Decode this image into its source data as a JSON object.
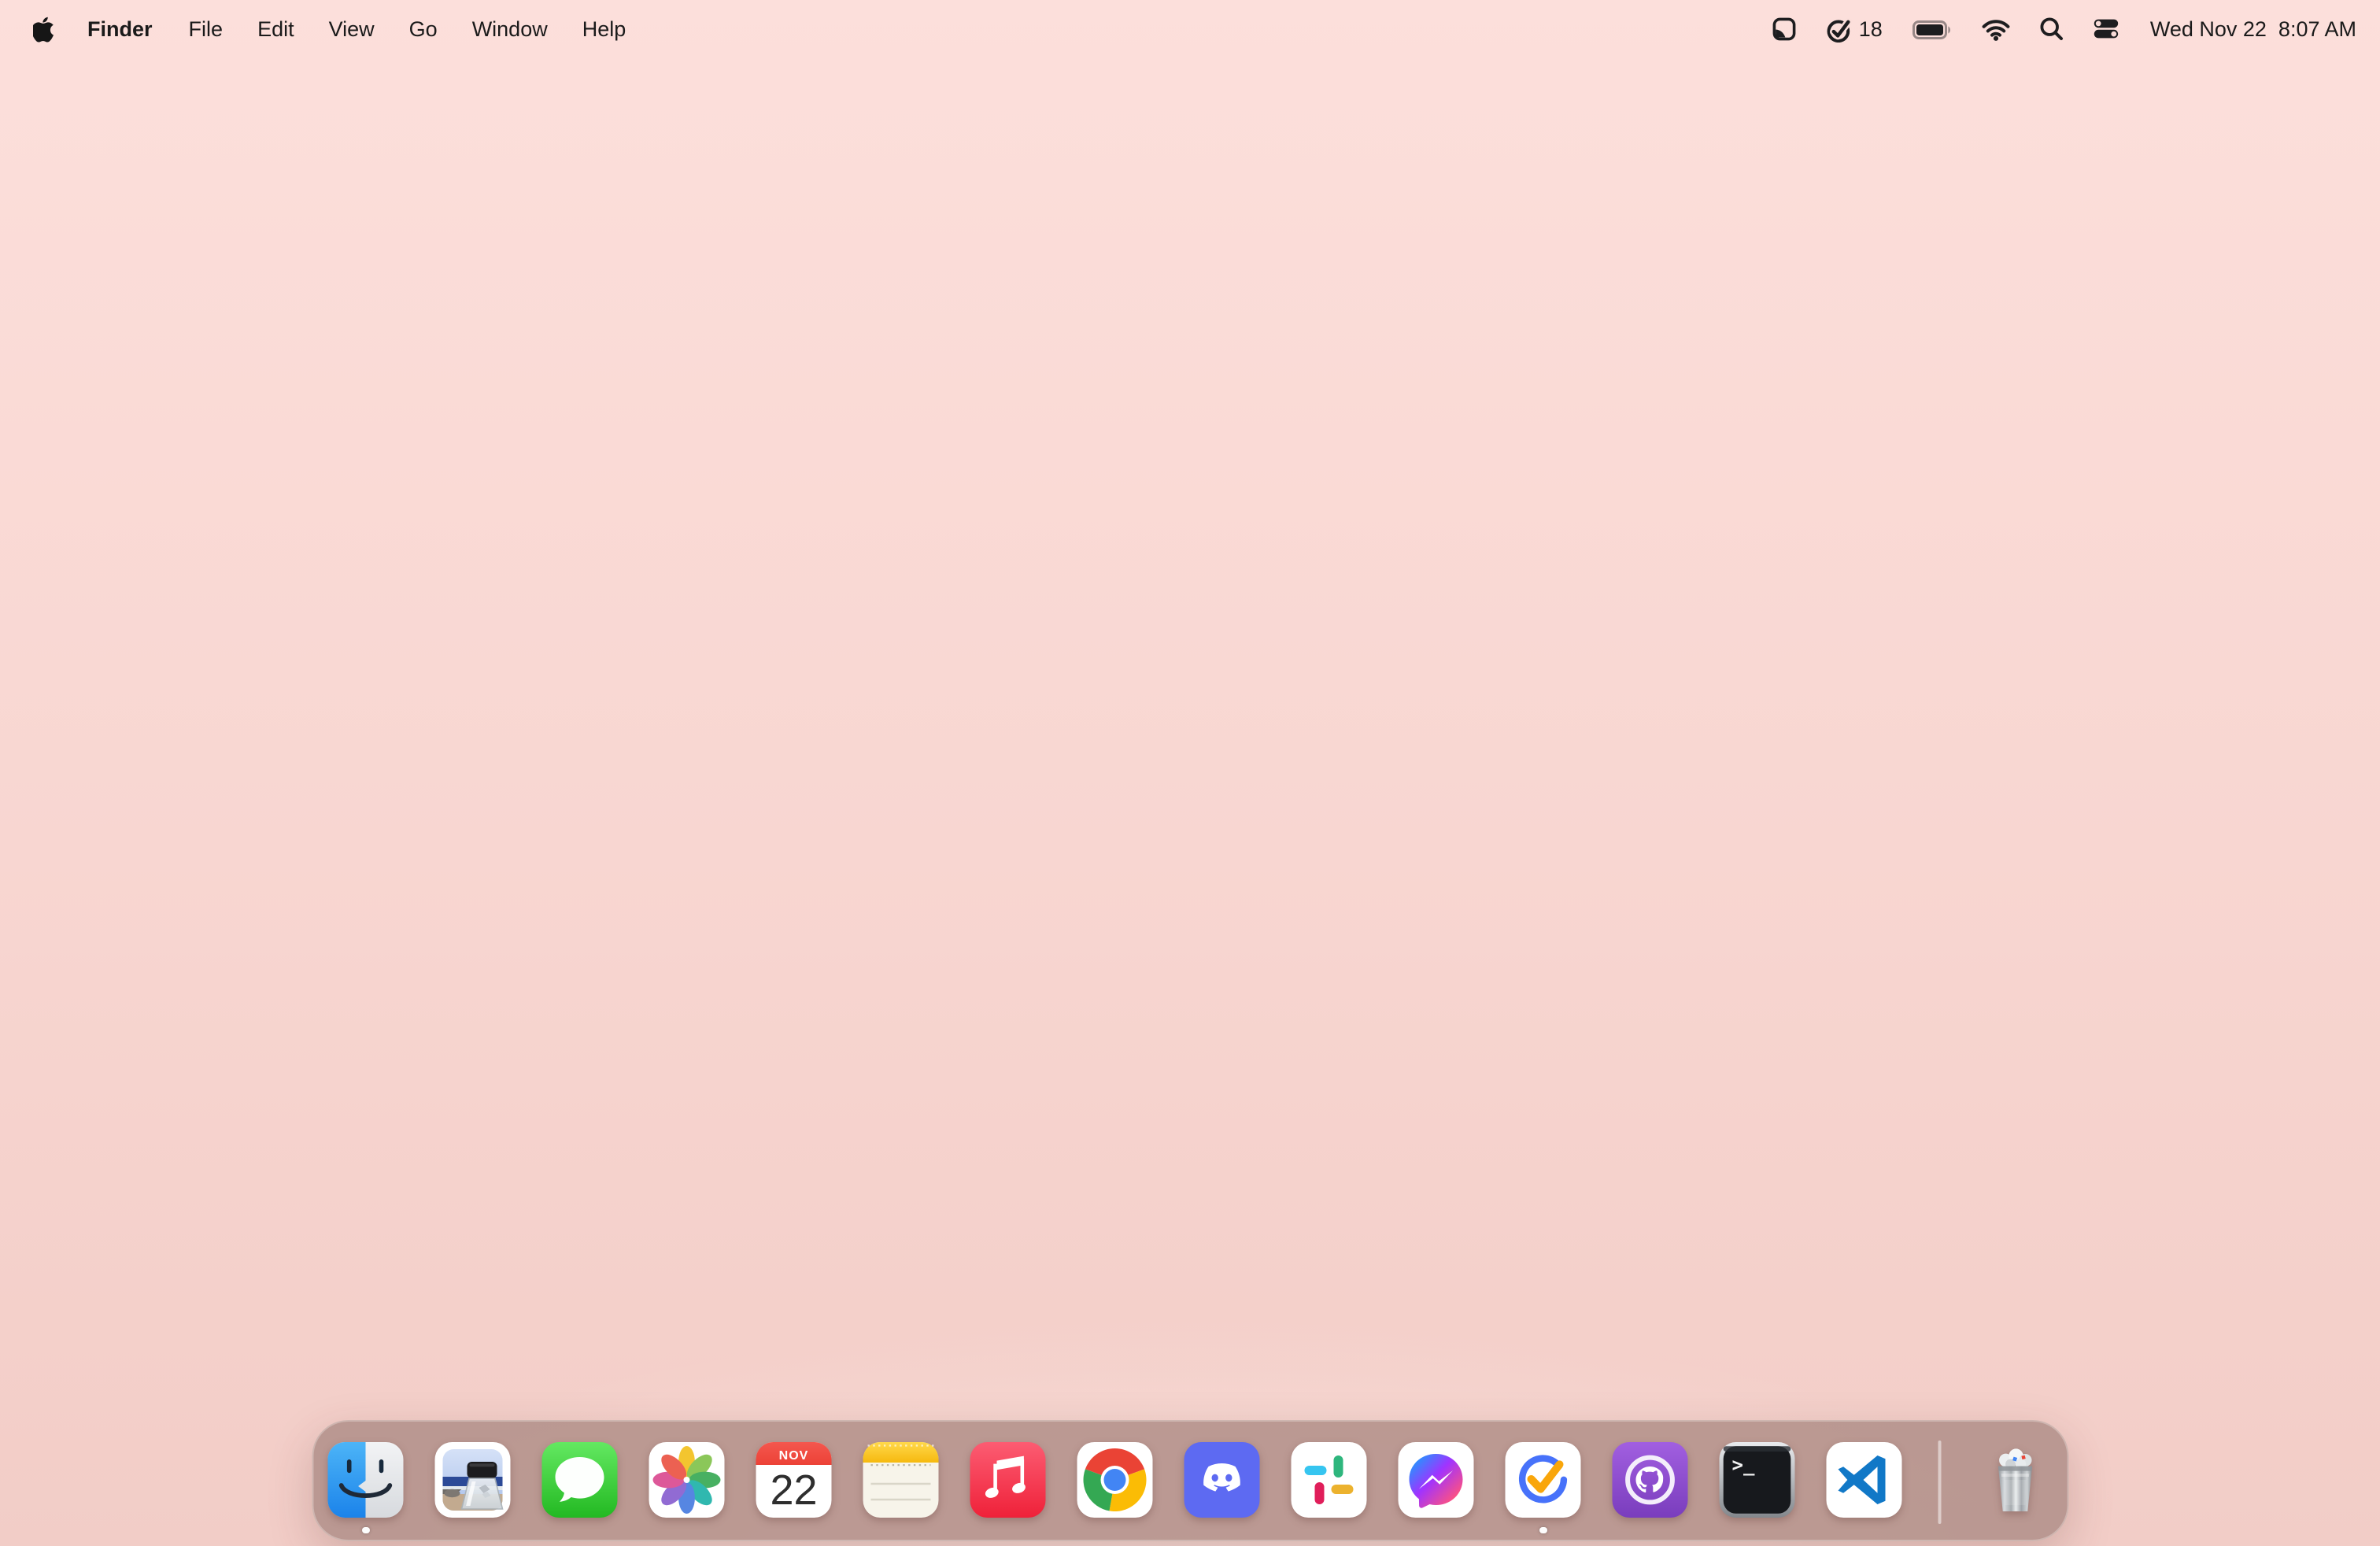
{
  "menu_bar": {
    "app_name": "Finder",
    "menus": [
      "File",
      "Edit",
      "View",
      "Go",
      "Window",
      "Help"
    ],
    "status": {
      "task_count": "18",
      "clock": "Wed Nov 22  8:07 AM",
      "icons": [
        "screenshot-utility-icon",
        "ticktick-check-icon",
        "battery-full-icon",
        "wifi-icon",
        "spotlight-search-icon",
        "control-center-icon"
      ]
    }
  },
  "dock": {
    "calendar_month": "NOV",
    "calendar_day": "22",
    "terminal_prompt": ">_",
    "items": [
      {
        "name": "finder",
        "running": true
      },
      {
        "name": "preview",
        "running": false
      },
      {
        "name": "messages",
        "running": false
      },
      {
        "name": "photos",
        "running": false
      },
      {
        "name": "calendar",
        "running": false
      },
      {
        "name": "notes",
        "running": false
      },
      {
        "name": "music",
        "running": false
      },
      {
        "name": "chrome",
        "running": false
      },
      {
        "name": "discord",
        "running": false
      },
      {
        "name": "slack",
        "running": false
      },
      {
        "name": "messenger",
        "running": false
      },
      {
        "name": "ticktick",
        "running": true
      },
      {
        "name": "github-desktop",
        "running": false
      },
      {
        "name": "terminal",
        "running": false
      },
      {
        "name": "vscode",
        "running": false
      },
      {
        "name": "trash-full",
        "running": false
      }
    ]
  },
  "colors": {
    "desktop_top": "#fcdfdb",
    "desktop_bottom": "#f2cdc7",
    "dock_background": "rgba(181,148,141,0.92)",
    "menu_text": "#1a1a1a",
    "ticktick_blue": "#4772fa",
    "ticktick_gold": "#f9a60a",
    "calendar_red": "#ee4438",
    "notes_yellow": "#fbc62b"
  }
}
